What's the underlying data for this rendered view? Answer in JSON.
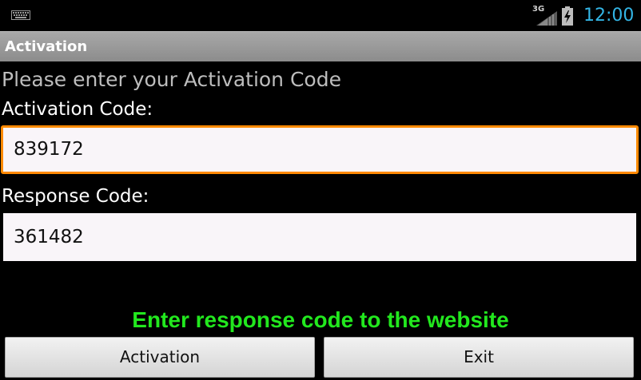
{
  "status_bar": {
    "keyboard_icon": "keyboard-icon",
    "network_label": "3G",
    "signal_icon": "signal-bars-icon",
    "battery_icon": "battery-charging-icon",
    "time": "12:00",
    "time_color": "#33b5e5"
  },
  "title_bar": {
    "title": "Activation"
  },
  "form": {
    "prompt": "Please enter your Activation Code",
    "activation_label": "Activation Code:",
    "activation_value": "839172",
    "response_label": "Response Code:",
    "response_value": "361482",
    "focus_color": "#ff8a00"
  },
  "hint": {
    "text": "Enter response code to the website",
    "color": "#22e81e"
  },
  "buttons": {
    "activation_label": "Activation",
    "exit_label": "Exit"
  }
}
